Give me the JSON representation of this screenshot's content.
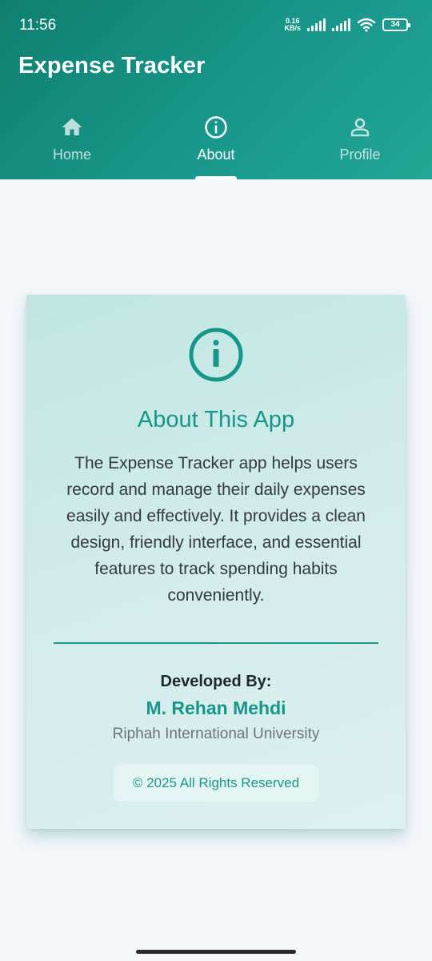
{
  "status_bar": {
    "time": "11:56",
    "net_speed_value": "0.16",
    "net_speed_unit": "KB/s",
    "battery_level": "34"
  },
  "app_bar": {
    "title": "Expense Tracker",
    "tabs": [
      {
        "label": "Home",
        "icon": "home-icon",
        "active": false
      },
      {
        "label": "About",
        "icon": "info-icon",
        "active": true
      },
      {
        "label": "Profile",
        "icon": "person-icon",
        "active": false
      }
    ]
  },
  "about_card": {
    "icon": "info-circle-icon",
    "title": "About This App",
    "description": "The Expense Tracker app helps users record and manage their daily expenses easily and effectively. It provides a clean design, friendly interface, and essential features to track spending habits conveniently.",
    "developed_by_label": "Developed By:",
    "developer_name": "M. Rehan Mehdi",
    "organization": "Riphah International University",
    "copyright": "© 2025 All Rights Reserved"
  },
  "colors": {
    "primary": "#16968a",
    "appbar_start": "#0f7f70",
    "appbar_end": "#23a596",
    "background": "#f4f6fa"
  }
}
